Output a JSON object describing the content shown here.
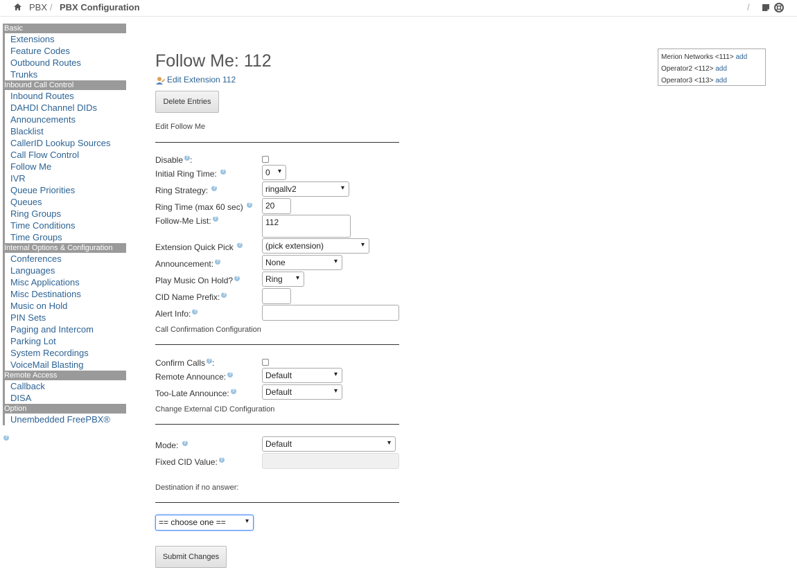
{
  "breadcrumb": {
    "root": "PBX",
    "separator": "/",
    "current": "PBX Configuration"
  },
  "sidebar": {
    "sections": [
      {
        "header": "Basic",
        "items": [
          "Extensions",
          "Feature Codes",
          "Outbound Routes",
          "Trunks"
        ]
      },
      {
        "header": "Inbound Call Control",
        "items": [
          "Inbound Routes",
          "DAHDI Channel DIDs",
          "Announcements",
          "Blacklist",
          "CallerID Lookup Sources",
          "Call Flow Control",
          "Follow Me",
          "IVR",
          "Queue Priorities",
          "Queues",
          "Ring Groups",
          "Time Conditions",
          "Time Groups"
        ]
      },
      {
        "header": "Internal Options & Configuration",
        "items": [
          "Conferences",
          "Languages",
          "Misc Applications",
          "Misc Destinations",
          "Music on Hold",
          "PIN Sets",
          "Paging and Intercom",
          "Parking Lot",
          "System Recordings",
          "VoiceMail Blasting"
        ]
      },
      {
        "header": "Remote Access",
        "items": [
          "Callback",
          "DISA"
        ]
      },
      {
        "header": "Option",
        "items": [
          "Unembedded FreePBX®"
        ]
      }
    ]
  },
  "page": {
    "title": "Follow Me: 112",
    "edit_link": "Edit Extension 112",
    "delete_button": "Delete Entries",
    "section_edit": "Edit Follow Me",
    "section_confirm": "Call Confirmation Configuration",
    "section_cid": "Change External CID Configuration",
    "section_dest": "Destination if no answer:",
    "submit_button": "Submit Changes"
  },
  "form": {
    "disable": {
      "label": "Disable",
      "suffix": ":"
    },
    "initial_ring_time": {
      "label": "Initial Ring Time:",
      "value": "0"
    },
    "ring_strategy": {
      "label": "Ring Strategy:",
      "value": "ringallv2"
    },
    "ring_time": {
      "label": "Ring Time (max 60 sec)",
      "value": "20"
    },
    "followme_list": {
      "label": "Follow-Me List:",
      "value": "112"
    },
    "quick_pick": {
      "label": "Extension Quick Pick",
      "value": "(pick extension)"
    },
    "announcement": {
      "label": "Announcement:",
      "value": "None"
    },
    "play_moh": {
      "label": "Play Music On Hold?",
      "value": "Ring"
    },
    "cid_prefix": {
      "label": "CID Name Prefix:",
      "value": ""
    },
    "alert_info": {
      "label": "Alert Info:",
      "value": ""
    },
    "confirm_calls": {
      "label": "Confirm Calls",
      "suffix": ":"
    },
    "remote_announce": {
      "label": "Remote Announce:",
      "value": "Default"
    },
    "too_late": {
      "label": "Too-Late Announce:",
      "value": "Default"
    },
    "mode": {
      "label": "Mode:",
      "value": "Default"
    },
    "fixed_cid": {
      "label": "Fixed CID Value:",
      "value": ""
    },
    "destination": {
      "value": "== choose one =="
    }
  },
  "extensions_panel": [
    {
      "name": "Merion Networks <111>",
      "action": "add"
    },
    {
      "name": "Operator2 <112>",
      "action": "add"
    },
    {
      "name": "Operator3 <113>",
      "action": "add"
    }
  ],
  "help_glyph": "?"
}
